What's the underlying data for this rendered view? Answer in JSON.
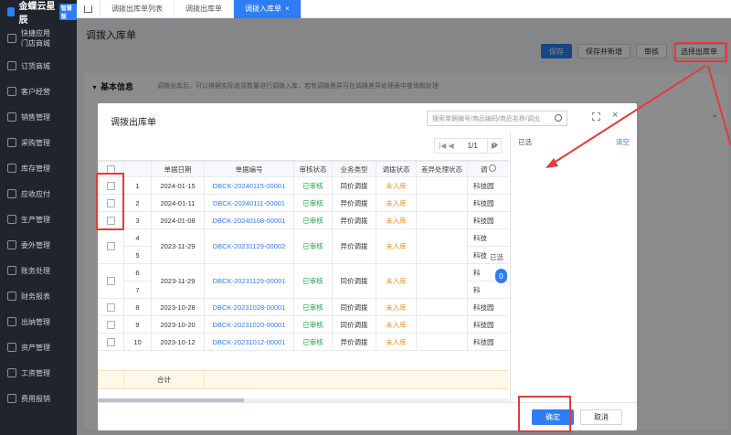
{
  "sidebar": {
    "logo": "金蝶云星辰",
    "badge": "智慧版",
    "items": [
      {
        "label": "快捷应用",
        "label2": "门店商城",
        "icon": "grid-icon"
      },
      {
        "label": "订货商城",
        "icon": "cart-icon"
      },
      {
        "label": "客户经营",
        "icon": "users-icon"
      },
      {
        "label": "销售管理",
        "icon": "sales-icon"
      },
      {
        "label": "采购管理",
        "icon": "purchase-icon"
      },
      {
        "label": "库存管理",
        "icon": "box-icon"
      },
      {
        "label": "应收应付",
        "icon": "money-icon"
      },
      {
        "label": "生产管理",
        "icon": "factory-icon"
      },
      {
        "label": "委外管理",
        "icon": "outsource-icon"
      },
      {
        "label": "账务处理",
        "icon": "ledger-icon"
      },
      {
        "label": "财务报表",
        "icon": "report-icon"
      },
      {
        "label": "出纳管理",
        "icon": "cash-icon"
      },
      {
        "label": "资产管理",
        "icon": "asset-icon"
      },
      {
        "label": "工资管理",
        "icon": "salary-icon"
      },
      {
        "label": "费用报销",
        "icon": "expense-icon"
      }
    ]
  },
  "topbar": {
    "tabs": [
      {
        "label": "调拨出库单列表"
      },
      {
        "label": "调拨出库单"
      },
      {
        "label": "调拨入库单",
        "close": "×"
      }
    ]
  },
  "page": {
    "title": "调拨入库单",
    "actions": {
      "save": "保存",
      "save_new": "保存并新增",
      "audit": "审核",
      "select": "选择出库单"
    },
    "section_title": "基本信息",
    "section_tri": "▼",
    "section_hint": "调拨出库后，可以根据实际收货数量进行调拨入库，若有调拨差异可在调拨差异处理表中查询和处理",
    "chevron": "⌄"
  },
  "dialog": {
    "title": "调拨出库单",
    "search_placeholder": "搜索单据编号/商品编码/商品名称/调出",
    "pager": {
      "prev": "|◀ ◀",
      "page": "1/1",
      "next": "▶"
    },
    "refresh": "⟳",
    "close": "×",
    "columns": [
      "",
      "",
      "单据日期",
      "单据编号",
      "审核状态",
      "业务类型",
      "调拨状态",
      "差异处理状态",
      "调"
    ],
    "rows": [
      {
        "no": "1",
        "date": "2024-01-15",
        "code": "DBCK-20240115-00001",
        "audit": "已审核",
        "type": "同价调拨",
        "status": "未入库",
        "diff": "",
        "tail": "科技园"
      },
      {
        "no": "2",
        "date": "2024-01-11",
        "code": "DBCK-20240111-00001",
        "audit": "已审核",
        "type": "异价调拨",
        "status": "未入库",
        "diff": "",
        "tail": "科技园"
      },
      {
        "no": "3",
        "date": "2024-01-08",
        "code": "DBCK-20240108-00001",
        "audit": "已审核",
        "type": "异价调拨",
        "status": "未入库",
        "diff": "",
        "tail": "科技园"
      },
      {
        "no": "4",
        "no2": "5",
        "date": "2023-11-29",
        "code": "DBCK-20231129-00002",
        "audit": "已审核",
        "type": "异价调拨",
        "status": "未入库",
        "diff": "",
        "tail": "科技",
        "tail2": "科技"
      },
      {
        "no": "6",
        "no2": "7",
        "date": "2023-11-29",
        "code": "DBCK-20231129-00001",
        "audit": "已审核",
        "type": "同价调拨",
        "status": "未入库",
        "diff": "",
        "tail": "科",
        "tail2": "科"
      },
      {
        "no": "8",
        "date": "2023-10-28",
        "code": "DBCK-20231028-00001",
        "audit": "已审核",
        "type": "同价调拨",
        "status": "未入库",
        "diff": "",
        "tail": "科技园"
      },
      {
        "no": "9",
        "date": "2023-10-20",
        "code": "DBCK-20231020-00001",
        "audit": "已审核",
        "type": "同价调拨",
        "status": "未入库",
        "diff": "",
        "tail": "科技园"
      },
      {
        "no": "10",
        "date": "2023-10-12",
        "code": "DBCK-20231012-00001",
        "audit": "已审核",
        "type": "异价调拨",
        "status": "未入库",
        "diff": "",
        "tail": "科技园"
      }
    ],
    "sum_label": "合计",
    "right": {
      "selected_label": "已选",
      "clear": "清空",
      "selected_side": "已选",
      "count": "0"
    },
    "ok": "确定",
    "cancel": "取消"
  },
  "colors": {
    "accent": "#2f7df6",
    "ok": "#2aa04a",
    "warn": "#f08c1e",
    "annotation": "#e23b3b"
  }
}
